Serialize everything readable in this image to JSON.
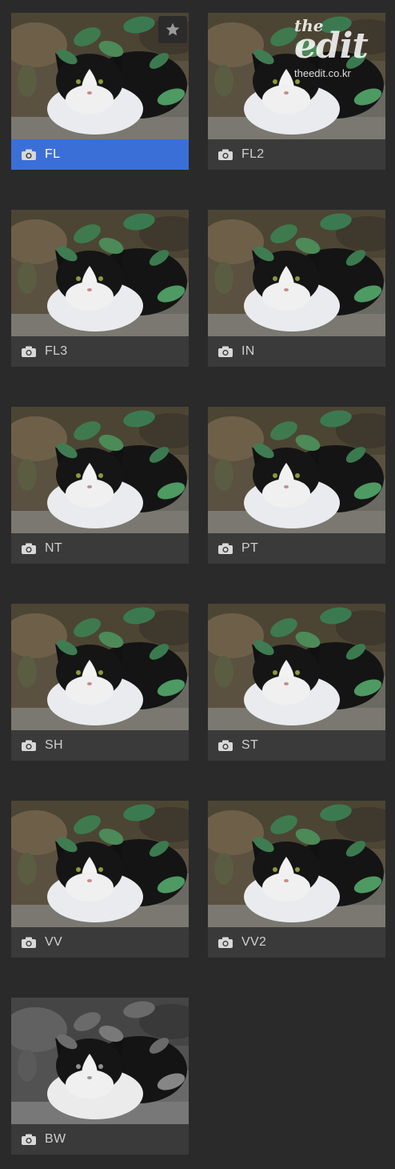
{
  "presets": [
    {
      "label": "FL",
      "selected": true,
      "favorite": true
    },
    {
      "label": "FL2"
    },
    {
      "label": "FL3"
    },
    {
      "label": "IN"
    },
    {
      "label": "NT"
    },
    {
      "label": "PT"
    },
    {
      "label": "SH"
    },
    {
      "label": "ST"
    },
    {
      "label": "VV"
    },
    {
      "label": "VV2"
    },
    {
      "label": "BW",
      "monochrome": true
    }
  ],
  "watermark": {
    "logo_top": "the",
    "logo_main": "edit",
    "url": "theedit.co.kr"
  },
  "icons": {
    "caption_icon": "camera-icon",
    "favorite_icon": "star-icon"
  },
  "colors": {
    "background": "#2a2a2a",
    "selected": "#3b6fd8",
    "caption": "#3a3a3a"
  }
}
